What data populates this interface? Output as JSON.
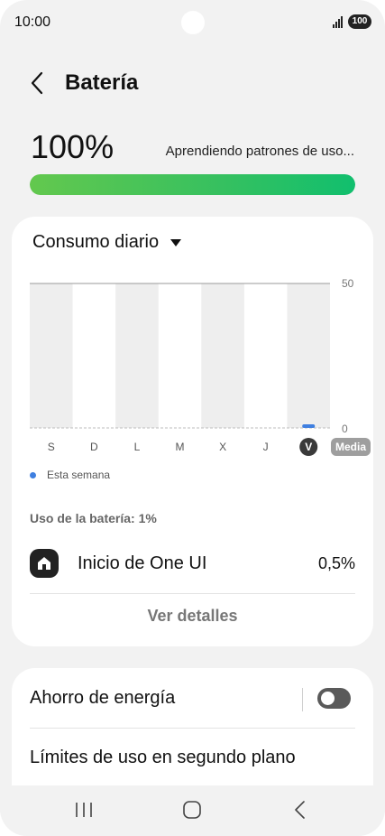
{
  "status": {
    "time": "10:00",
    "battery": "100"
  },
  "header": {
    "title": "Batería"
  },
  "battery": {
    "percent_text": "100%",
    "status_text": "Aprendiendo patrones de uso...",
    "level": 1.0
  },
  "usage_card": {
    "dropdown_label": "Consumo diario",
    "legend_label": "Esta semana",
    "usage_label": "Uso de la batería: 1%",
    "app": {
      "name": "Inicio de One UI",
      "percent": "0,5%",
      "icon": "home-icon"
    },
    "details_label": "Ver detalles"
  },
  "chart_data": {
    "type": "bar",
    "categories": [
      "S",
      "D",
      "L",
      "M",
      "X",
      "J",
      "V"
    ],
    "values": [
      0,
      0,
      0,
      0,
      0,
      0,
      1
    ],
    "ylim": [
      0,
      50
    ],
    "y_tick_labels": [
      "50",
      "0"
    ],
    "average_label": "Media",
    "selected_category": "V",
    "series": [
      {
        "name": "Esta semana",
        "color": "#3f7fe0",
        "values": [
          0,
          0,
          0,
          0,
          0,
          0,
          1
        ]
      }
    ],
    "legend_position": "bottom-left",
    "grid": true
  },
  "settings": {
    "power_saving": "Ahorro de energía",
    "power_saving_on": false,
    "background_limits": "Límites de uso en segundo plano"
  },
  "navbar": {
    "recents_icon": "recents-icon",
    "home_icon": "home-circle-icon",
    "back_icon": "back-icon"
  },
  "colors": {
    "accent": "#3f7fe0",
    "level_start": "#63c84e",
    "level_end": "#11bf6e"
  }
}
